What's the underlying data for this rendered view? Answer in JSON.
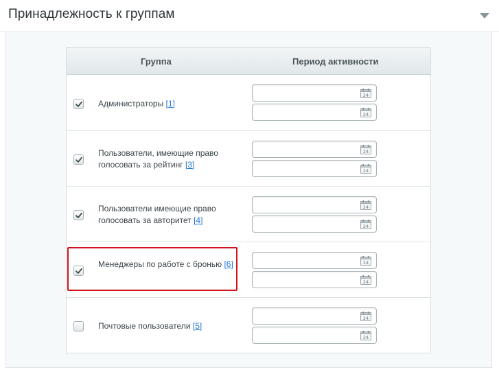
{
  "section": {
    "title": "Принадлежность к группам"
  },
  "table": {
    "headers": {
      "group": "Группа",
      "period": "Период активности"
    },
    "rows": [
      {
        "checked": true,
        "label": "Администраторы",
        "id_text": "[1]",
        "from": "",
        "to": ""
      },
      {
        "checked": true,
        "label": "Пользователи, имеющие право голосовать за рейтинг",
        "id_text": "[3]",
        "from": "",
        "to": ""
      },
      {
        "checked": true,
        "label": "Пользователи имеющие право голосовать за авторитет",
        "id_text": "[4]",
        "from": "",
        "to": ""
      },
      {
        "checked": true,
        "label": "Менеджеры по работе с бронью",
        "id_text": "[6]",
        "from": "",
        "to": ""
      },
      {
        "checked": false,
        "label": "Почтовые пользователи",
        "id_text": "[5]",
        "from": "",
        "to": ""
      }
    ]
  },
  "calendar_icon_text": "24",
  "colors": {
    "link": "#2675d7",
    "highlight": "#d1141c"
  }
}
